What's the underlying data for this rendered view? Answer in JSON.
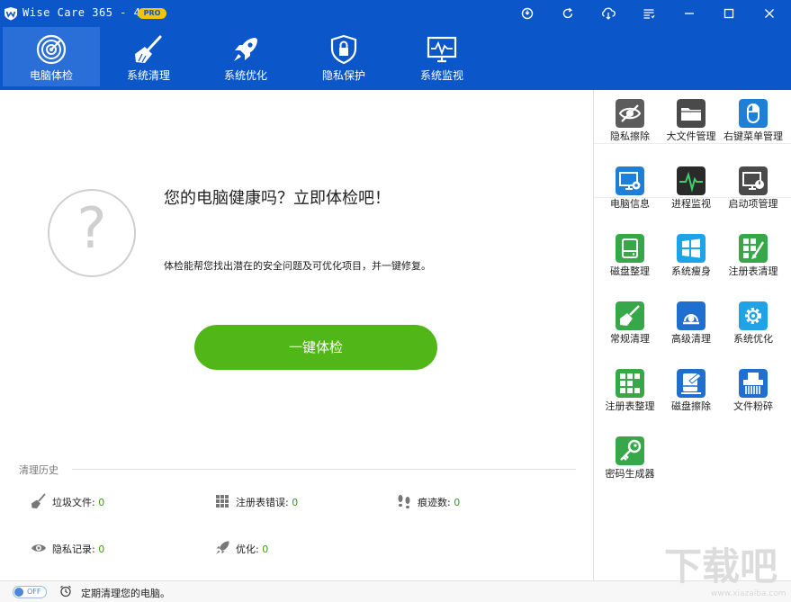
{
  "window": {
    "title": "Wise Care 365 - 4.26",
    "badge": "PRO",
    "buttons": [
      "update-icon",
      "refresh-icon",
      "cloud-icon",
      "menu-icon",
      "minimize-icon",
      "maximize-icon",
      "close-icon"
    ]
  },
  "nav": {
    "tabs": [
      {
        "label": "电脑体检",
        "icon": "radar-icon",
        "active": true
      },
      {
        "label": "系统清理",
        "icon": "broom-icon",
        "active": false
      },
      {
        "label": "系统优化",
        "icon": "rocket-icon",
        "active": false
      },
      {
        "label": "隐私保护",
        "icon": "shield-lock-icon",
        "active": false
      },
      {
        "label": "系统监视",
        "icon": "monitor-pulse-icon",
        "active": false
      }
    ]
  },
  "main": {
    "headline": "您的电脑健康吗？立即体检吧！",
    "description": "体检能帮您找出潜在的安全问题及可优化项目，并一键修复。",
    "check_button": "一键体检",
    "history": {
      "title": "清理历史",
      "stats": [
        {
          "label": "垃圾文件",
          "value": "0",
          "icon": "broom-icon"
        },
        {
          "label": "注册表错误",
          "value": "0",
          "icon": "grid-icon"
        },
        {
          "label": "痕迹数",
          "value": "0",
          "icon": "footprints-icon"
        },
        {
          "label": "隐私记录",
          "value": "0",
          "icon": "eye-icon"
        },
        {
          "label": "优化",
          "value": "0",
          "icon": "rocket-icon"
        }
      ]
    }
  },
  "tools": [
    {
      "label": "隐私擦除",
      "icon": "eye-off-icon",
      "color": "#5c5c5c"
    },
    {
      "label": "大文件管理",
      "icon": "folder-icon",
      "color": "#4a4a4a"
    },
    {
      "label": "右键菜单管理",
      "icon": "mouse-icon",
      "color": "#1e7fd6"
    },
    {
      "label": "电脑信息",
      "icon": "pc-gear-icon",
      "color": "#1e7fd6"
    },
    {
      "label": "进程监视",
      "icon": "pulse-icon",
      "color": "#2f9d45"
    },
    {
      "label": "启动项管理",
      "icon": "power-icon",
      "color": "#4a4a4a"
    },
    {
      "label": "磁盘整理",
      "icon": "disk-icon",
      "color": "#36a84a"
    },
    {
      "label": "系统瘦身",
      "icon": "windows-icon",
      "color": "#1ea3e6"
    },
    {
      "label": "注册表清理",
      "icon": "registry-icon",
      "color": "#36a84a"
    },
    {
      "label": "常规清理",
      "icon": "broom-icon",
      "color": "#36a84a"
    },
    {
      "label": "高级清理",
      "icon": "vacuum-icon",
      "color": "#1e6fd0"
    },
    {
      "label": "系统优化",
      "icon": "gear-icon",
      "color": "#1ea3e6"
    },
    {
      "label": "注册表整理",
      "icon": "blocks-icon",
      "color": "#36a84a"
    },
    {
      "label": "磁盘擦除",
      "icon": "disk-erase-icon",
      "color": "#1e6fd0"
    },
    {
      "label": "文件粉碎",
      "icon": "shredder-icon",
      "color": "#1e6fd0"
    },
    {
      "label": "密码生成器",
      "icon": "key-icon",
      "color": "#36a84a"
    }
  ],
  "bottom": {
    "toggle_state": "OFF",
    "schedule_text": "定期清理您的电脑。"
  },
  "watermark": {
    "text": "下载吧",
    "domain": "www.xiazaiba.com"
  },
  "colors": {
    "brand_blue": "#0b57c9",
    "active_tab": "#2a6fd8",
    "button_green": "#51b617",
    "value_green": "#3f9a18",
    "badge_yellow": "#f6c400"
  }
}
